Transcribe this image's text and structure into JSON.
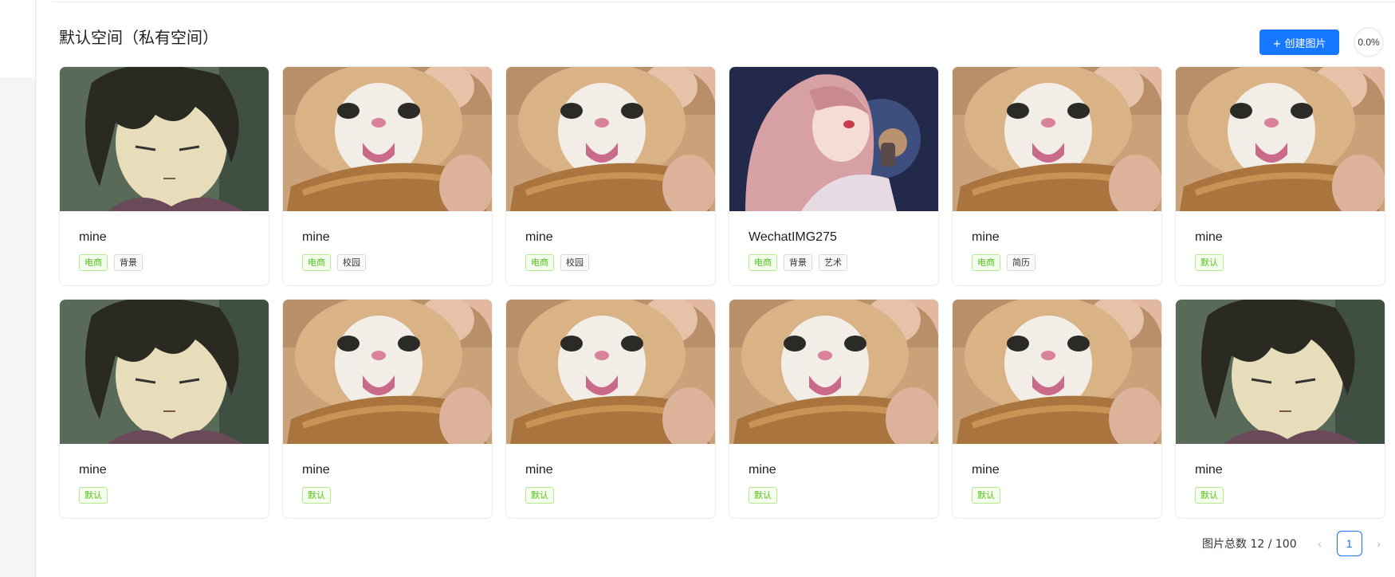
{
  "page": {
    "title": "默认空间（私有空间）",
    "create_button": "+ 创建图片",
    "usage_percent": "0.0%",
    "accent_color": "#1677ff"
  },
  "pictures": [
    {
      "name": "mine",
      "image": "anime-boy",
      "tags": [
        "电商",
        "背景"
      ]
    },
    {
      "name": "mine",
      "image": "cat-bread",
      "tags": [
        "电商",
        "校园"
      ]
    },
    {
      "name": "mine",
      "image": "cat-bread",
      "tags": [
        "电商",
        "校园"
      ]
    },
    {
      "name": "WechatIMG275",
      "image": "anime-girl",
      "tags": [
        "电商",
        "背景",
        "艺术"
      ]
    },
    {
      "name": "mine",
      "image": "cat-bread",
      "tags": [
        "电商",
        "简历"
      ]
    },
    {
      "name": "mine",
      "image": "cat-bread",
      "tags": [
        "默认"
      ]
    },
    {
      "name": "mine",
      "image": "anime-boy",
      "tags": [
        "默认"
      ]
    },
    {
      "name": "mine",
      "image": "cat-bread",
      "tags": [
        "默认"
      ]
    },
    {
      "name": "mine",
      "image": "cat-bread",
      "tags": [
        "默认"
      ]
    },
    {
      "name": "mine",
      "image": "cat-bread",
      "tags": [
        "默认"
      ]
    },
    {
      "name": "mine",
      "image": "cat-bread",
      "tags": [
        "默认"
      ]
    },
    {
      "name": "mine",
      "image": "anime-boy",
      "tags": [
        "默认"
      ]
    }
  ],
  "tag_colors": {
    "电商": "green",
    "默认": "green"
  },
  "pagination": {
    "total_label": "图片总数 12 / 100",
    "current_page": "1",
    "prev_icon": "‹",
    "next_icon": "›"
  }
}
